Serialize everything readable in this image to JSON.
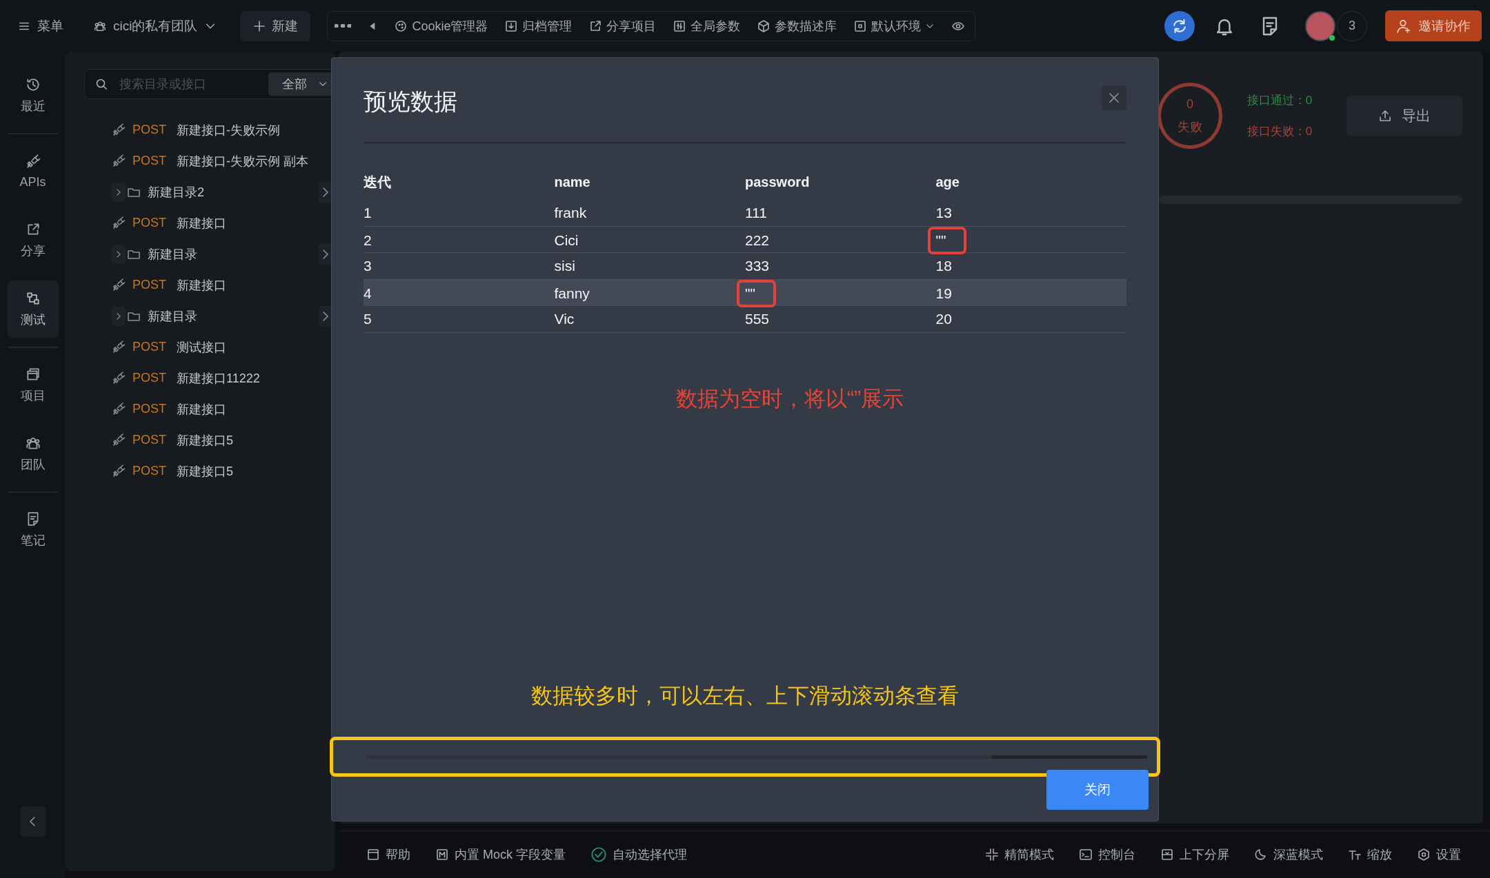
{
  "top_bar": {
    "menu": "菜单",
    "team": "cici的私有团队",
    "new_button": "新建",
    "tools": [
      {
        "kind": "cookie",
        "label": "Cookie管理器"
      },
      {
        "kind": "archive",
        "label": "归档管理"
      },
      {
        "kind": "share",
        "label": "分享项目"
      },
      {
        "kind": "params",
        "label": "全局参数"
      },
      {
        "kind": "box",
        "label": "参数描述库"
      },
      {
        "kind": "env",
        "label": "默认环境"
      }
    ],
    "member_count": "3",
    "invite_button": "邀请协作"
  },
  "rail": [
    {
      "kind": "recent",
      "label": "最近",
      "selected": false
    },
    {
      "kind": "api",
      "label": "APIs",
      "selected": false
    },
    {
      "kind": "share",
      "label": "分享",
      "selected": false
    },
    {
      "kind": "test",
      "label": "测试",
      "selected": true
    },
    {
      "kind": "project",
      "label": "项目",
      "selected": false
    },
    {
      "kind": "team",
      "label": "团队",
      "selected": false
    },
    {
      "kind": "note",
      "label": "笔记",
      "selected": false
    }
  ],
  "tree": {
    "search": {
      "placeholder": "搜索目录或接口"
    },
    "filter": "全部",
    "items": [
      {
        "kind": "api",
        "method": "POST",
        "name": "新建接口-失败示例"
      },
      {
        "kind": "api",
        "method": "POST",
        "name": "新建接口-失败示例 副本"
      },
      {
        "kind": "folder",
        "name": "新建目录2",
        "expanded": false
      },
      {
        "kind": "api",
        "method": "POST",
        "name": "新建接口"
      },
      {
        "kind": "folder",
        "name": "新建目录",
        "expanded": false
      },
      {
        "kind": "api",
        "method": "POST",
        "name": "新建接口"
      },
      {
        "kind": "folder",
        "name": "新建目录",
        "expanded": false
      },
      {
        "kind": "api",
        "method": "POST",
        "name": "测试接口"
      },
      {
        "kind": "api",
        "method": "POST",
        "name": "新建接口11222"
      },
      {
        "kind": "api",
        "method": "POST",
        "name": "新建接口"
      },
      {
        "kind": "api",
        "method": "POST",
        "name": "新建接口5"
      },
      {
        "kind": "api",
        "method": "POST",
        "name": "新建接口5"
      }
    ]
  },
  "report": {
    "ring_count": "0",
    "ring_label": "失败",
    "passed": "接口通过：0",
    "failed": "接口失败：0",
    "export_button": "导出"
  },
  "dialog": {
    "title": "预览数据",
    "table": {
      "columns": [
        "迭代",
        "name",
        "password",
        "age"
      ],
      "rows": [
        {
          "selected": false,
          "cells": [
            {
              "text": "1",
              "boxed": false
            },
            {
              "text": "frank",
              "boxed": false
            },
            {
              "text": "111",
              "boxed": false
            },
            {
              "text": "13",
              "boxed": false
            }
          ]
        },
        {
          "selected": false,
          "cells": [
            {
              "text": "2",
              "boxed": false
            },
            {
              "text": "Cici",
              "boxed": false
            },
            {
              "text": "222",
              "boxed": false
            },
            {
              "text": "\"\"",
              "boxed": true
            }
          ]
        },
        {
          "selected": false,
          "cells": [
            {
              "text": "3",
              "boxed": false
            },
            {
              "text": "sisi",
              "boxed": false
            },
            {
              "text": "333",
              "boxed": false
            },
            {
              "text": "18",
              "boxed": false
            }
          ]
        },
        {
          "selected": true,
          "cells": [
            {
              "text": "4",
              "boxed": false
            },
            {
              "text": "fanny",
              "boxed": false
            },
            {
              "text": "\"\"",
              "boxed": true
            },
            {
              "text": "19",
              "boxed": false
            }
          ]
        },
        {
          "selected": false,
          "cells": [
            {
              "text": "5",
              "boxed": false
            },
            {
              "text": "Vic",
              "boxed": false
            },
            {
              "text": "555",
              "boxed": false
            },
            {
              "text": "20",
              "boxed": false
            }
          ]
        }
      ]
    },
    "empty_note": "数据为空时，将以“”展示",
    "scroll_note": "数据较多时，可以左右、上下滑动滚动条查看",
    "close_button": "关闭"
  },
  "bottom_bar": {
    "left": [
      {
        "kind": "help",
        "label": "帮助"
      },
      {
        "kind": "mock",
        "label": "内置 Mock 字段变量"
      },
      {
        "kind": "proxy",
        "label": "自动选择代理"
      }
    ],
    "right": [
      {
        "kind": "compact",
        "label": "精简模式"
      },
      {
        "kind": "console",
        "label": "控制台"
      },
      {
        "kind": "split",
        "label": "上下分屏"
      },
      {
        "kind": "theme",
        "label": "深蓝模式"
      },
      {
        "kind": "zoom",
        "label": "缩放"
      },
      {
        "kind": "settings",
        "label": "设置"
      }
    ]
  }
}
